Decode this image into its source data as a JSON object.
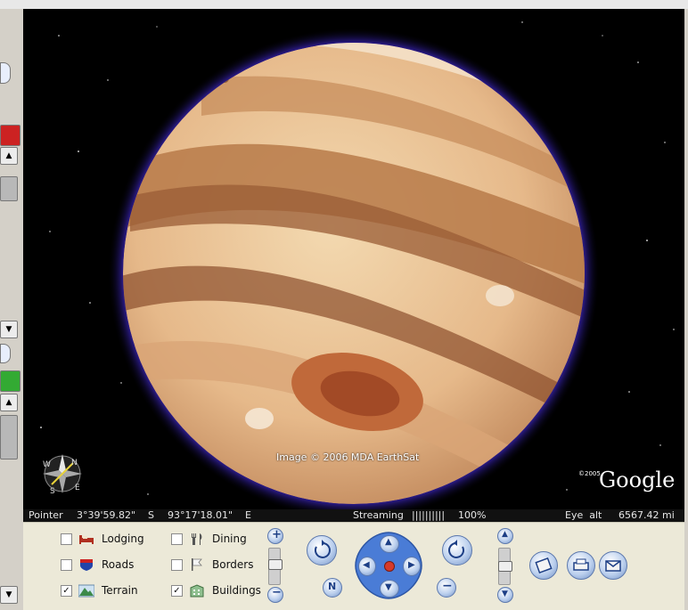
{
  "viewport": {
    "attribution": "Image © 2006 MDA EarthSat",
    "logo_copyright": "©2005",
    "logo_text": "Google"
  },
  "status": {
    "pointer_label": "Pointer",
    "pointer_lat": "3°39'59.82\"",
    "pointer_lat_dir": "S",
    "pointer_lon": "93°17'18.01\"",
    "pointer_lon_dir": "E",
    "streaming_label": "Streaming",
    "streaming_bars": "||||||||||",
    "streaming_percent": "100%",
    "eye_alt_label": "Eye  alt",
    "eye_alt_value": "6567.42 mi"
  },
  "layers": [
    {
      "label": "Lodging",
      "checked": false,
      "icon": "bed-icon"
    },
    {
      "label": "Roads",
      "checked": false,
      "icon": "road-sign-icon"
    },
    {
      "label": "Terrain",
      "checked": true,
      "icon": "mountain-icon"
    },
    {
      "label": "Dining",
      "checked": false,
      "icon": "fork-knife-icon"
    },
    {
      "label": "Borders",
      "checked": false,
      "icon": "flag-icon"
    },
    {
      "label": "Buildings",
      "checked": true,
      "icon": "building-icon"
    }
  ],
  "colors": {
    "planet_glow": "#5a3df0",
    "sidebar_red": "#cc2222",
    "sidebar_green": "#33aa33",
    "nav_blue": "#4a7cd6"
  }
}
